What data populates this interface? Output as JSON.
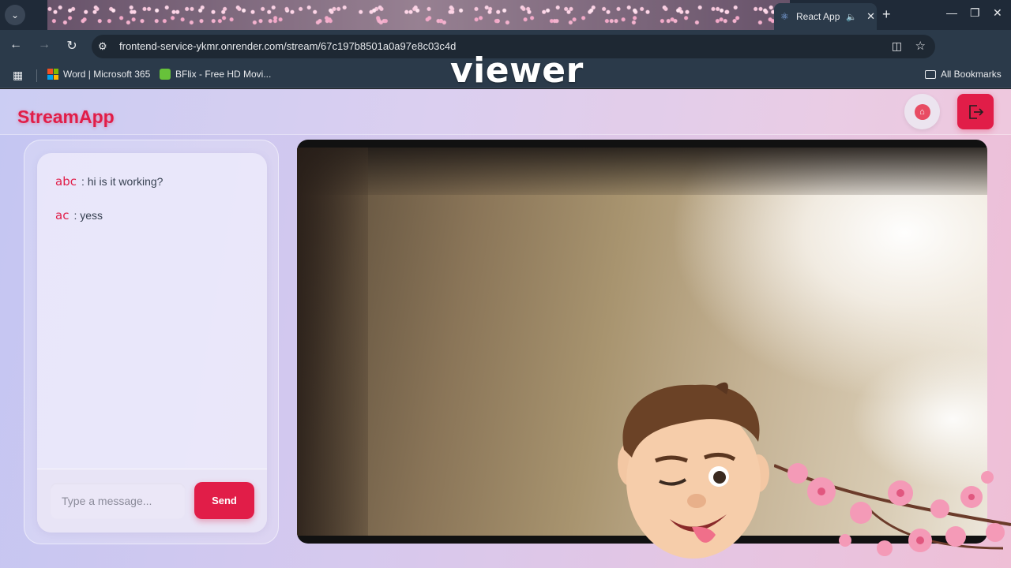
{
  "browser": {
    "active_tab_title": "React App",
    "url": "frontend-service-ykmr.onrender.com/stream/67c197b8501a0a97e8c03c4d",
    "bookmarks": [
      {
        "label": "Word | Microsoft 365"
      },
      {
        "label": "BFlix - Free HD Movi..."
      }
    ],
    "all_bookmarks_label": "All Bookmarks"
  },
  "overlay_caption": "viewer",
  "app": {
    "brand": "StreamApp"
  },
  "chat": {
    "messages": [
      {
        "user": "abc",
        "text": ": hi is it working?"
      },
      {
        "user": "ac",
        "text": ": yess"
      }
    ],
    "input_placeholder": "Type a message...",
    "send_label": "Send"
  },
  "colors": {
    "accent": "#e11d48",
    "chrome_bg": "#2b3a4a"
  },
  "icons": {
    "home": "home-icon",
    "logout": "logout-icon"
  }
}
